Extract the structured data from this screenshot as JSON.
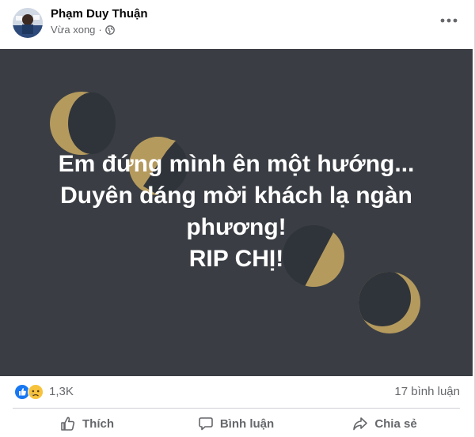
{
  "post": {
    "author": "Phạm Duy Thuận",
    "timestamp": "Vừa xong",
    "privacy_icon": "globe-icon",
    "more_icon": "ellipsis-icon",
    "image_lines": [
      "Em đứng mình ên một hướng...",
      "Duyên dáng mời khách lạ ngàn",
      "phương!",
      "RIP CHỊ!"
    ]
  },
  "reactions": {
    "icons": [
      "like-icon",
      "sad-icon"
    ],
    "count": "1,3K",
    "comments": "17 bình luận"
  },
  "actions": {
    "like": "Thích",
    "comment": "Bình luận",
    "share": "Chia sẻ"
  },
  "colors": {
    "background": "#3a3e44",
    "moon_gold": "#b59a5e",
    "moon_shadow": "#2f343a",
    "like_blue": "#1877f2",
    "sad_yellow": "#f7c23c",
    "muted_text": "#65676b"
  }
}
